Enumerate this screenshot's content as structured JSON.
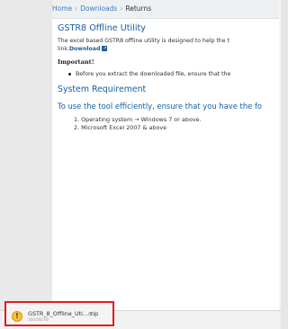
{
  "breadcrumb": {
    "home": "Home",
    "downloads": "Downloads",
    "current": "Returns",
    "separator": "›"
  },
  "main": {
    "title": "GSTR8 Offline Utility",
    "description_line1": "The excel based GSTR8 offline utility is designed to help the t",
    "description_line2_prefix": "link.",
    "download_link": "Download",
    "important_label": "Important!",
    "bullet_text": "Before you extract the downloaded file, ensure that the"
  },
  "requirements": {
    "title": "System Requirement",
    "subtitle": "To use the tool efficiently, ensure that you have the fo",
    "items": [
      "1. Operating system → Windows 7 or above.",
      "2. Microsoft Excel 2007 & above"
    ]
  },
  "download_bar": {
    "filename": "GSTR_8_Offline_Uti....zip",
    "size": "160/160 kB",
    "chevron": "^",
    "warning_glyph": "!"
  },
  "colors": {
    "accent": "#1a5fa0",
    "highlight_border": "#e21b22",
    "warning": "#f5c23b"
  }
}
